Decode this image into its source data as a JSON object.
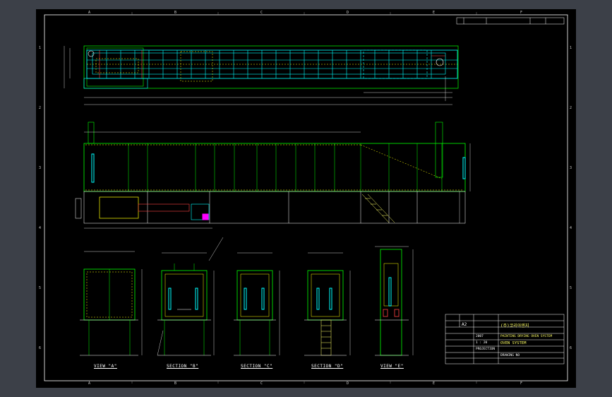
{
  "zones": {
    "top": [
      "A",
      "B",
      "C",
      "D",
      "E",
      "F"
    ],
    "bottom": [
      "A",
      "B",
      "C",
      "D",
      "E",
      "F"
    ],
    "left": [
      "1",
      "2",
      "3",
      "4",
      "5",
      "6"
    ],
    "right": [
      "1",
      "2",
      "3",
      "4",
      "5",
      "6"
    ]
  },
  "view_labels": [
    "VIEW \"A\"",
    "SECTION \"B\"",
    "SECTION \"C\"",
    "SECTION \"D\"",
    "VIEW \"E\""
  ],
  "title_block": {
    "size": "A2",
    "company": "(주)코리아엔지",
    "project": "PAINTING DRYING OVEN SYSTEM",
    "title": "OVEN SYSTEM",
    "drawing_no": "DRAWING NO",
    "scale": "1 : 20",
    "date": "2007",
    "projection": "PROJECTION"
  },
  "colors": {
    "frame": "#ffffff",
    "structure": "#00ff00",
    "duct": "#00ffff",
    "dimension": "#ffffff",
    "accent": "#ffff00",
    "burner": "#ff00ff",
    "hidden": "#ff3333"
  }
}
